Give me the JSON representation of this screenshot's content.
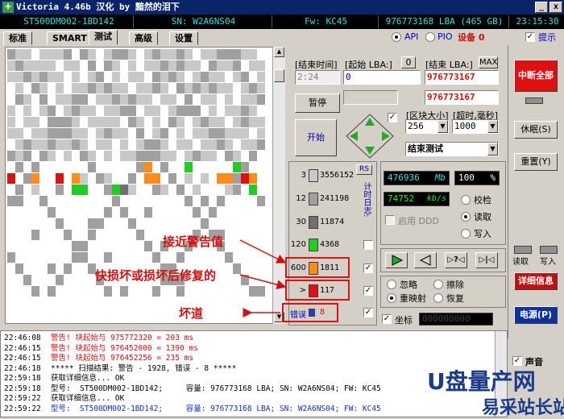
{
  "window": {
    "title": "Victoria 4.46b 汉化 by 黯然的泪下",
    "minimize": "_",
    "close": "x"
  },
  "infobar": {
    "model": "ST500DM002-1BD142",
    "serial": "SN: W2A6NS04",
    "firmware": "Fw: KC45",
    "capacity": "976773168 LBA (465 GB)",
    "time": "23:15:30"
  },
  "tabs": [
    "标准",
    "SMART",
    "测试",
    "高级",
    "设置"
  ],
  "active_tab": "测试",
  "interface": {
    "api_label": "API",
    "pio_label": "PIO",
    "device_label": "设备 0",
    "hint_label": "提示"
  },
  "test": {
    "end_time_label": "[结束时间]",
    "start_lba_label": "[起始 LBA:]",
    "start_lba_btn": "0",
    "end_lba_label": "[结束 LBA:]",
    "max_btn": "MAX",
    "time_value": "2:24",
    "start_lba_value": "0",
    "end_lba_value": "976773167",
    "end_lba_value2": "976773167",
    "pause_btn": "暂停",
    "start_btn": "开始",
    "block_size_label": "[区块大小]",
    "timeout_label": "[超时,毫秒]",
    "block_size": "256",
    "timeout": "1000",
    "end_action": "结束测试"
  },
  "stats": {
    "rs_btn": "RS",
    "side_label": "计时日志:",
    "rows": [
      {
        "label": "3",
        "count": "3556152",
        "color": "#c8c8c8"
      },
      {
        "label": "12",
        "count": "241198",
        "color": "#a0a0a0"
      },
      {
        "label": "30",
        "count": "11874",
        "color": "#707070"
      },
      {
        "label": "120",
        "count": "4368",
        "color": "#22cc22"
      },
      {
        "label": "600",
        "count": "1811",
        "color": "#ff8c1a"
      },
      {
        "label": ">",
        "count": "117",
        "color": "#e01010"
      },
      {
        "label": "错误",
        "count": "8",
        "color": "#2040c0"
      }
    ]
  },
  "progress": {
    "mb_value": "476936",
    "mb_unit": "Mb",
    "percent": "100",
    "percent_unit": "%",
    "speed_value": "74752",
    "speed_unit": "kb/s",
    "ddd_label": "启用 DDD",
    "mode_verify": "校检",
    "mode_read": "读取",
    "mode_write": "写入"
  },
  "actions": {
    "ignore": "忽略",
    "erase": "擦除",
    "remap": "重映射",
    "restore": "恢复",
    "grid_label": "坐标",
    "grid_value": "000000000"
  },
  "right_panel": {
    "break_all": "中断全部",
    "sleep": "休眠(S)",
    "reset": "重置(Y)",
    "read_label": "读取",
    "write_label": "写入",
    "details": "详细信息",
    "power": "电源(P)",
    "sound_label": "声音"
  },
  "annotations": {
    "near_warning": "接近警告值",
    "damaged": "快损坏或损坏后修复的",
    "bad": "坏道"
  },
  "log": [
    {
      "time": "22:46:08",
      "msg": "警告! 块起始与 975772320 = 203 ms",
      "color": "#d01010"
    },
    {
      "time": "22:46:15",
      "msg": "警告! 块起始与 976452000 = 1390 ms",
      "color": "#d01010"
    },
    {
      "time": "22:46:15",
      "msg": "警告! 块起始与 976452256 = 235 ms",
      "color": "#d01010"
    },
    {
      "time": "22:46:18",
      "msg": "***** 扫描结果: 警告 - 1928, 错误 - 8 *****",
      "color": "#000000"
    },
    {
      "time": "22:59:18",
      "msg": "获取详细信息... OK",
      "color": "#000000"
    },
    {
      "time": "22:59:18",
      "msg": "型号:  ST500DM002-1BD142;     容量: 976773168 LBA; SN: W2A6NS04; FW: KC45",
      "color": "#000000"
    },
    {
      "time": "22:59:22",
      "msg": "获取详细信息... OK",
      "color": "#000000"
    },
    {
      "time": "22:59:22",
      "msg": "型号:  ST500DM002-1BD142;     容量: 976773168 LBA; SN: W2A6NS04; FW: KC45",
      "color": "#1030c0"
    }
  ],
  "watermark": {
    "brand": "U盘量产网",
    "site": "易采站长站"
  },
  "colors": {
    "gray_light": "#c8c8c8",
    "gray_mid": "#a0a0a0",
    "gray_dark": "#707070",
    "green": "#22cc22",
    "orange": "#ff8c1a",
    "red": "#e01010"
  }
}
